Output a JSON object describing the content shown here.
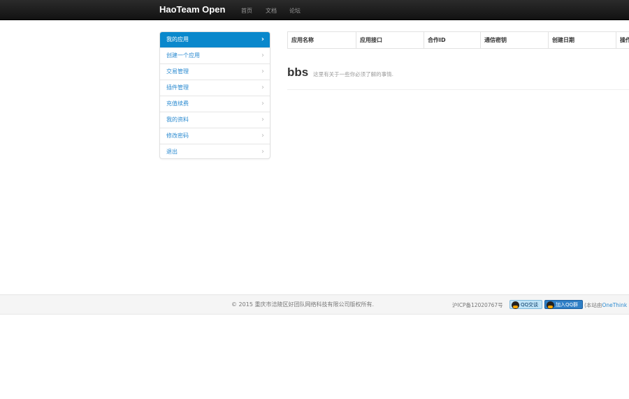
{
  "navbar": {
    "brand": "HaoTeam Open",
    "links": [
      "首页",
      "文档",
      "论坛"
    ]
  },
  "sidebar": {
    "items": [
      {
        "label": "我的应用",
        "active": true
      },
      {
        "label": "创建一个应用"
      },
      {
        "label": "交易管理"
      },
      {
        "label": "插件管理"
      },
      {
        "label": "充值续费"
      },
      {
        "label": "我的资料"
      },
      {
        "label": "修改密码"
      },
      {
        "label": "退出"
      }
    ]
  },
  "table": {
    "headers": [
      "应用名称",
      "应用接口",
      "合作ID",
      "通信密钥",
      "创建日期",
      "操作"
    ]
  },
  "heading": {
    "title": "bbs",
    "subtitle": "这里有关于一些你必须了解的事情."
  },
  "footer": {
    "copyright": "© 2015 重庆市涪陵区好团队网络科技有限公司版权所有.",
    "icp": "沪ICP备12020767号",
    "qq_chat": "QQ交谈",
    "qq_group": "加入QQ群",
    "powered_prefix": "(本站由",
    "powered_link": "OneThink"
  },
  "colors": {
    "accent": "#0a88cc",
    "link": "#2a8ad0",
    "navbar": "#1b1b1b"
  }
}
